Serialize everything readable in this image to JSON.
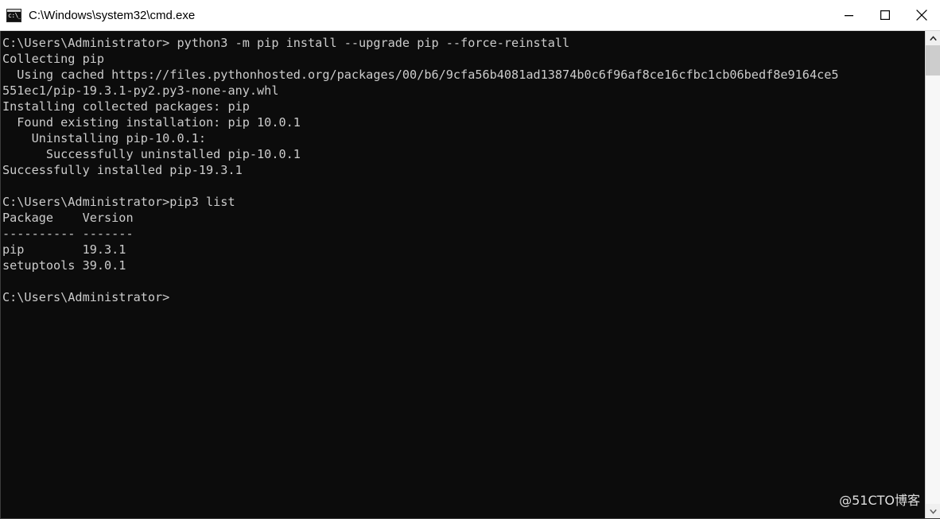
{
  "window": {
    "title": "C:\\Windows\\system32\\cmd.exe",
    "icon_name": "cmd-icon",
    "icon_glyph": "c:\\_",
    "controls": {
      "minimize_label": "Minimize",
      "maximize_label": "Maximize",
      "close_label": "Close"
    }
  },
  "terminal": {
    "background_color": "#0c0c0c",
    "foreground_color": "#cccccc",
    "content": "C:\\Users\\Administrator> python3 -m pip install --upgrade pip --force-reinstall\nCollecting pip\n  Using cached https://files.pythonhosted.org/packages/00/b6/9cfa56b4081ad13874b0c6f96af8ce16cfbc1cb06bedf8e9164ce5\n551ec1/pip-19.3.1-py2.py3-none-any.whl\nInstalling collected packages: pip\n  Found existing installation: pip 10.0.1\n    Uninstalling pip-10.0.1:\n      Successfully uninstalled pip-10.0.1\nSuccessfully installed pip-19.3.1\n\nC:\\Users\\Administrator>pip3 list\nPackage    Version\n---------- -------\npip        19.3.1\nsetuptools 39.0.1\n\nC:\\Users\\Administrator>",
    "lines": [
      "C:\\Users\\Administrator> python3 -m pip install --upgrade pip --force-reinstall",
      "Collecting pip",
      "  Using cached https://files.pythonhosted.org/packages/00/b6/9cfa56b4081ad13874b0c6f96af8ce16cfbc1cb06bedf8e9164ce5",
      "551ec1/pip-19.3.1-py2.py3-none-any.whl",
      "Installing collected packages: pip",
      "  Found existing installation: pip 10.0.1",
      "    Uninstalling pip-10.0.1:",
      "      Successfully uninstalled pip-10.0.1",
      "Successfully installed pip-19.3.1",
      "",
      "C:\\Users\\Administrator>pip3 list",
      "Package    Version",
      "---------- -------",
      "pip        19.3.1",
      "setuptools 39.0.1",
      "",
      "C:\\Users\\Administrator>"
    ],
    "package_table": {
      "columns": [
        "Package",
        "Version"
      ],
      "rows": [
        [
          "pip",
          "19.3.1"
        ],
        [
          "setuptools",
          "39.0.1"
        ]
      ]
    },
    "prompt": "C:\\Users\\Administrator>",
    "commands": [
      "python3 -m pip install --upgrade pip --force-reinstall",
      "pip3 list"
    ]
  },
  "scrollbar": {
    "up_arrow_name": "scroll-up-arrow",
    "down_arrow_name": "scroll-down-arrow",
    "thumb_name": "scroll-thumb"
  },
  "watermark": {
    "text": "@51CTO博客"
  }
}
